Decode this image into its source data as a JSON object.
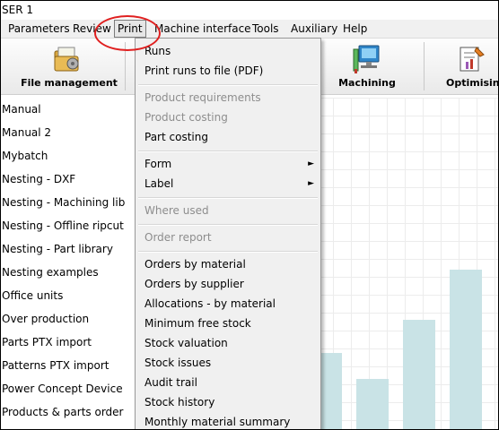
{
  "window": {
    "title": "SER 1"
  },
  "menubar": {
    "items": [
      "Parameters",
      "Review",
      "Print",
      "Machine interface",
      "Tools",
      "Auxiliary",
      "Help"
    ]
  },
  "toolbar": {
    "file_management": "File management",
    "machining": "Machining",
    "optimising": "Optimisin"
  },
  "left_list": [
    "Manual",
    "Manual 2",
    "Mybatch",
    "Nesting - DXF",
    "Nesting - Machining lib",
    "Nesting - Offline ripcut",
    "Nesting - Part library",
    "Nesting examples",
    "Office units",
    "Over production",
    "Parts PTX import",
    "Patterns PTX import",
    "Power Concept Device",
    "Products & parts order"
  ],
  "print_menu": {
    "runs": "Runs",
    "print_runs_to_file": "Print runs to file (PDF)",
    "product_requirements": "Product requirements",
    "product_costing": "Product costing",
    "part_costing": "Part costing",
    "form": "Form",
    "label": "Label",
    "where_used": "Where used",
    "order_report": "Order report",
    "orders_by_material": "Orders by material",
    "orders_by_supplier": "Orders by supplier",
    "allocations_by_material": "Allocations - by material",
    "minimum_free_stock": "Minimum free stock",
    "stock_valuation": "Stock valuation",
    "stock_issues": "Stock issues",
    "audit_trail": "Audit trail",
    "stock_history": "Stock history",
    "monthly_material_summary": "Monthly material summary",
    "submenu_arrow": "►"
  },
  "colors": {
    "highlight_ellipse": "#e02020",
    "chart_bar": "#c9e3e6"
  },
  "chart_data": {
    "type": "bar",
    "values": [
      0.23,
      0.15,
      0.33,
      0.48
    ],
    "note_units": "fraction of visible plot height"
  }
}
